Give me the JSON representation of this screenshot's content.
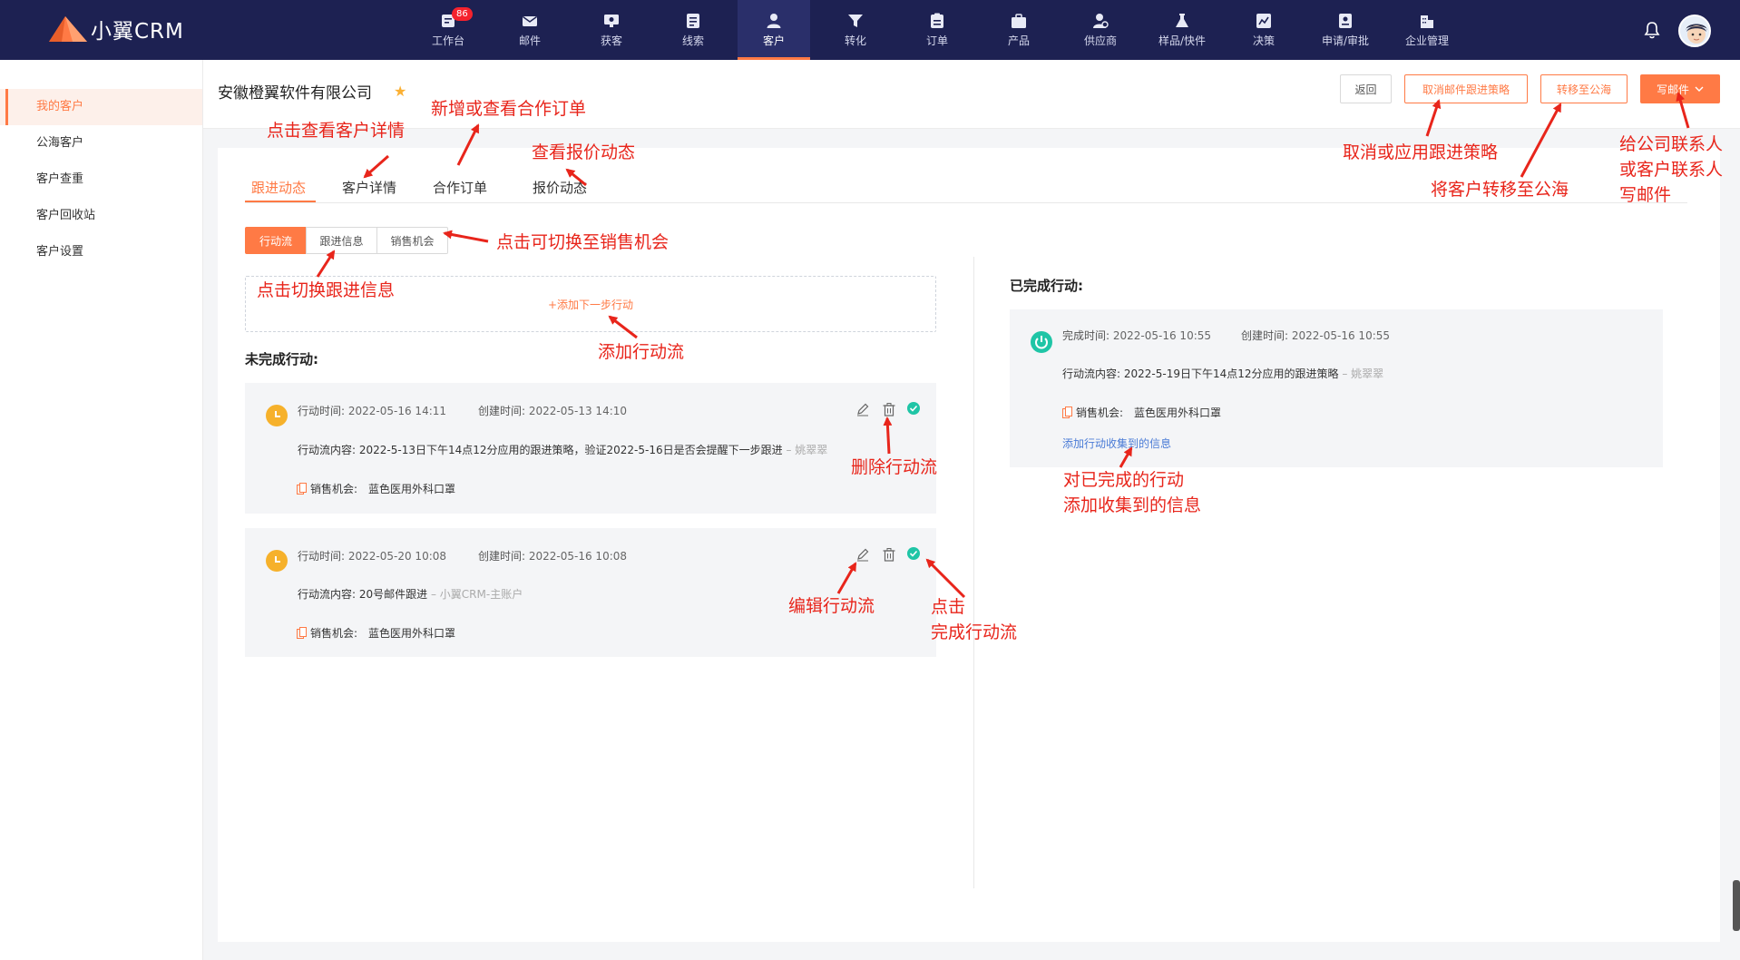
{
  "app": {
    "name": "小翼CRM"
  },
  "nav": [
    {
      "label": "工作台",
      "icon": "workbench-icon",
      "badge": "86"
    },
    {
      "label": "邮件",
      "icon": "mail-icon"
    },
    {
      "label": "获客",
      "icon": "acquire-icon"
    },
    {
      "label": "线索",
      "icon": "clue-icon"
    },
    {
      "label": "客户",
      "icon": "customer-icon",
      "active": true
    },
    {
      "label": "转化",
      "icon": "funnel-icon"
    },
    {
      "label": "订单",
      "icon": "order-icon"
    },
    {
      "label": "产品",
      "icon": "product-icon"
    },
    {
      "label": "供应商",
      "icon": "supplier-icon"
    },
    {
      "label": "样品/快件",
      "icon": "sample-icon"
    },
    {
      "label": "决策",
      "icon": "decision-icon"
    },
    {
      "label": "申请/审批",
      "icon": "approval-icon"
    },
    {
      "label": "企业管理",
      "icon": "enterprise-icon"
    }
  ],
  "sidebar": {
    "items": [
      {
        "label": "我的客户",
        "active": true
      },
      {
        "label": "公海客户"
      },
      {
        "label": "客户查重"
      },
      {
        "label": "客户回收站"
      },
      {
        "label": "客户设置"
      }
    ]
  },
  "header": {
    "company": "安徽橙翼软件有限公司",
    "buttons": {
      "back": "返回",
      "cancel_strategy": "取消邮件跟进策略",
      "transfer": "转移至公海",
      "write_mail": "写邮件"
    }
  },
  "tabs": [
    {
      "label": "跟进动态",
      "active": true
    },
    {
      "label": "客户详情"
    },
    {
      "label": "合作订单"
    },
    {
      "label": "报价动态"
    }
  ],
  "segments": [
    "行动流",
    "跟进信息",
    "销售机会"
  ],
  "add_action": "+添加下一步行动",
  "incomplete_title": "未完成行动:",
  "completed_title": "已完成行动:",
  "incomplete_actions": [
    {
      "action_time_label": "行动时间:",
      "action_time": "2022-05-16 14:11",
      "created_label": "创建时间:",
      "created_time": "2022-05-13 14:10",
      "content_label": "行动流内容:",
      "content": "2022-5-13日下午14点12分应用的跟进策略，验证2022-5-16日是否会提醒下一步跟进",
      "author": "– 姚翠翠",
      "opp_label": "销售机会:",
      "opp": "蓝色医用外科口罩"
    },
    {
      "action_time_label": "行动时间:",
      "action_time": "2022-05-20 10:08",
      "created_label": "创建时间:",
      "created_time": "2022-05-16 10:08",
      "content_label": "行动流内容:",
      "content": "20号邮件跟进",
      "author": "– 小翼CRM-主账户",
      "opp_label": "销售机会:",
      "opp": "蓝色医用外科口罩"
    }
  ],
  "completed_actions": [
    {
      "done_time_label": "完成时间:",
      "done_time": "2022-05-16 10:55",
      "created_label": "创建时间:",
      "created_time": "2022-05-16 10:55",
      "content_label": "行动流内容:",
      "content": "2022-5-19日下午14点12分应用的跟进策略",
      "author": "– 姚翠翠",
      "opp_label": "销售机会:",
      "opp": "蓝色医用外科口罩",
      "add_info": "添加行动收集到的信息"
    }
  ],
  "annotations": {
    "customer_detail": "点击查看客户详情",
    "orders": "新增或查看合作订单",
    "quotes": "查看报价动态",
    "cancel_strategy": "取消或应用跟进策略",
    "transfer": "将客户转移至公海",
    "mail_line1": "给公司联系人",
    "mail_line2": "或客户联系人",
    "mail_line3": "写邮件",
    "switch_opp": "点击可切换至销售机会",
    "switch_follow": "点击切换跟进信息",
    "add_flow": "添加行动流",
    "delete_flow": "删除行动流",
    "edit_flow": "编辑行动流",
    "complete_line1": "点击",
    "complete_line2": "完成行动流",
    "collect_line1": "对已完成的行动",
    "collect_line2": "添加收集到的信息"
  },
  "colors": {
    "accent": "#ff7a45",
    "nav_bg": "#1d2152",
    "annotation": "#e8251b",
    "complete": "#1fc5a6",
    "pending": "#f6b12b"
  }
}
